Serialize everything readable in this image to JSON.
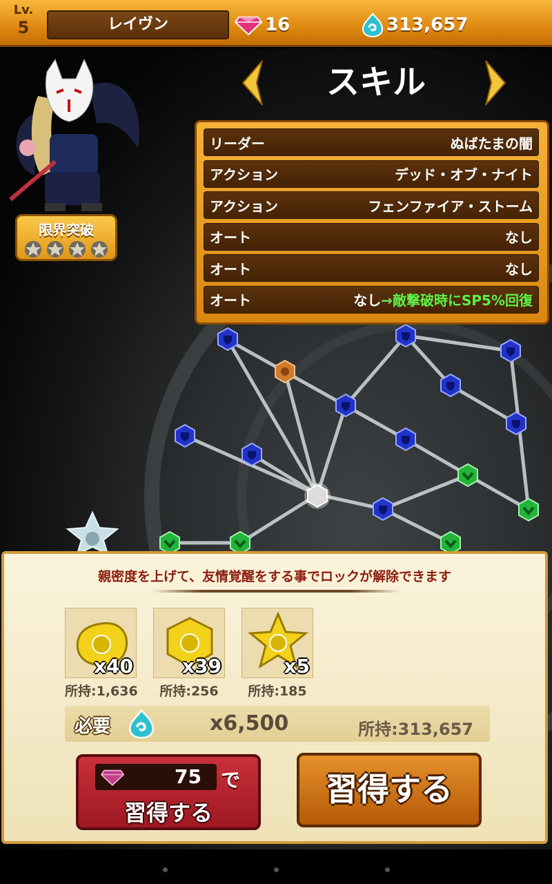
{
  "header": {
    "level_label": "Lv.",
    "level": "5",
    "character_name": "レイヴン",
    "gems": "16",
    "currency": "313,657"
  },
  "character": {
    "limit_break_label": "限界突破",
    "limit_break_stars": 4
  },
  "skill_section": {
    "title": "スキル",
    "skills": [
      {
        "type": "リーダー",
        "name": "ぬばたまの闇"
      },
      {
        "type": "アクション",
        "name": "デッド・オブ・ナイト"
      },
      {
        "type": "アクション",
        "name": "フェンファイア・ストーム"
      },
      {
        "type": "オート",
        "name": "なし"
      },
      {
        "type": "オート",
        "name": "なし"
      },
      {
        "type": "オート",
        "name": "なし",
        "upgrade": "→敵撃破時にSP5%回復"
      }
    ]
  },
  "unlock_panel": {
    "notice": "親密度を上げて、友情覚醒をする事でロックが解除できます",
    "materials": [
      {
        "icon": "gold-orb-icon",
        "qty": "x40",
        "owned": "所持:1,636"
      },
      {
        "icon": "gold-hexagon-icon",
        "qty": "x39",
        "owned": "所持:256"
      },
      {
        "icon": "gold-star-icon",
        "qty": "x5",
        "owned": "所持:185"
      }
    ],
    "required_label": "必要",
    "required_amount": "x6,500",
    "required_owned": "所持:313,657",
    "gem_button": {
      "count": "75",
      "de": "で",
      "label": "習得する"
    },
    "learn_button": "習得する"
  },
  "colors": {
    "header_orange": "#e9961c",
    "panel_brown": "#4f2a09",
    "highlight_green": "#5ff04a",
    "node_blue": "#2233c8",
    "node_green": "#22b43a",
    "gem_button_red": "#b3222c"
  }
}
